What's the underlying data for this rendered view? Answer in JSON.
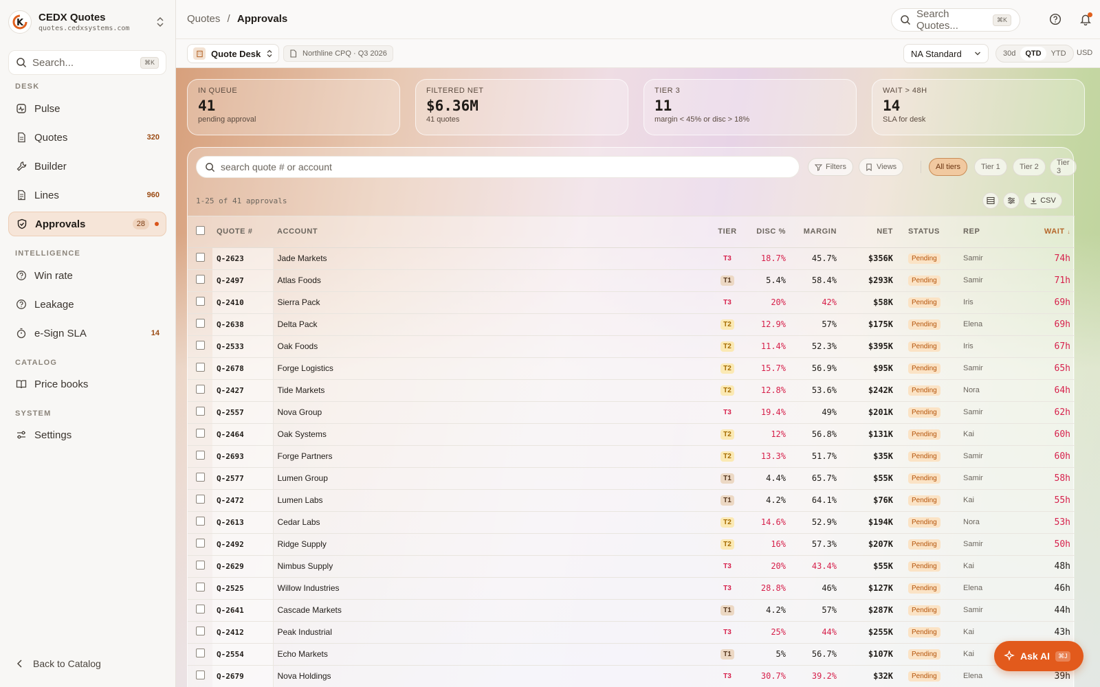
{
  "brand": {
    "name": "CEDX Quotes",
    "domain": "quotes.cedxsystems.com",
    "logo_letter": "K"
  },
  "sidebar": {
    "search_placeholder": "Search...",
    "search_shortcut": "⌘K",
    "sections": {
      "desk": "DESK",
      "intelligence": "INTELLIGENCE",
      "catalog": "CATALOG",
      "system": "SYSTEM"
    },
    "items": [
      {
        "label": "Pulse",
        "icon": "pulse-icon"
      },
      {
        "label": "Quotes",
        "count": "320",
        "icon": "document-icon"
      },
      {
        "label": "Builder",
        "icon": "wrench-icon"
      },
      {
        "label": "Lines",
        "count": "960",
        "icon": "list-icon"
      },
      {
        "label": "Approvals",
        "count": "28",
        "icon": "shield-check-icon",
        "active": true
      },
      {
        "label": "Win rate",
        "icon": "question-icon"
      },
      {
        "label": "Leakage",
        "icon": "question-icon"
      },
      {
        "label": "e-Sign SLA",
        "count": "14",
        "icon": "stopwatch-icon"
      },
      {
        "label": "Price books",
        "icon": "book-icon"
      },
      {
        "label": "Settings",
        "icon": "sliders-icon"
      }
    ],
    "back_label": "Back to Catalog"
  },
  "header": {
    "breadcrumb_parent": "Quotes",
    "breadcrumb_sep": "/",
    "breadcrumb_current": "Approvals",
    "search_placeholder": "Search Quotes...",
    "search_shortcut": "⌘K"
  },
  "toolbar": {
    "desk_label": "Quote Desk",
    "project_label": "Northline CPQ · Q3 2026",
    "region": "NA Standard",
    "ranges": [
      "30d",
      "QTD",
      "YTD"
    ],
    "active_range": "QTD",
    "currency": "USD"
  },
  "kpis": [
    {
      "label": "IN QUEUE",
      "value": "41",
      "sub": "pending approval"
    },
    {
      "label": "FILTERED NET",
      "value": "$6.36M",
      "sub": "41 quotes"
    },
    {
      "label": "TIER 3",
      "value": "11",
      "sub": "margin < 45% or disc > 18%"
    },
    {
      "label": "WAIT > 48H",
      "value": "14",
      "sub": "SLA for desk"
    }
  ],
  "filters": {
    "search_placeholder": "search quote # or account",
    "filters_label": "Filters",
    "views_label": "Views",
    "tiers": [
      "All tiers",
      "Tier 1",
      "Tier 2",
      "Tier 3"
    ],
    "active_tier": "All tiers",
    "result_count": "1-25 of 41 approvals",
    "csv_label": "CSV"
  },
  "table": {
    "columns": {
      "quote": "QUOTE #",
      "account": "ACCOUNT",
      "tier": "TIER",
      "disc": "DISC %",
      "margin": "MARGIN",
      "net": "NET",
      "status": "STATUS",
      "rep": "REP",
      "wait": "WAIT"
    },
    "rows": [
      {
        "quote": "Q-2623",
        "account": "Jade Markets",
        "tier": "T3",
        "disc": "18.7%",
        "disc_red": true,
        "margin": "45.7%",
        "margin_red": false,
        "net": "$356K",
        "status": "Pending",
        "rep": "Samir",
        "wait": "74h",
        "wait_red": true
      },
      {
        "quote": "Q-2497",
        "account": "Atlas Foods",
        "tier": "T1",
        "disc": "5.4%",
        "disc_red": false,
        "margin": "58.4%",
        "margin_red": false,
        "net": "$293K",
        "status": "Pending",
        "rep": "Samir",
        "wait": "71h",
        "wait_red": true
      },
      {
        "quote": "Q-2410",
        "account": "Sierra Pack",
        "tier": "T3",
        "disc": "20%",
        "disc_red": true,
        "margin": "42%",
        "margin_red": true,
        "net": "$58K",
        "status": "Pending",
        "rep": "Iris",
        "wait": "69h",
        "wait_red": true
      },
      {
        "quote": "Q-2638",
        "account": "Delta Pack",
        "tier": "T2",
        "disc": "12.9%",
        "disc_red": true,
        "margin": "57%",
        "margin_red": false,
        "net": "$175K",
        "status": "Pending",
        "rep": "Elena",
        "wait": "69h",
        "wait_red": true
      },
      {
        "quote": "Q-2533",
        "account": "Oak Foods",
        "tier": "T2",
        "disc": "11.4%",
        "disc_red": true,
        "margin": "52.3%",
        "margin_red": false,
        "net": "$395K",
        "status": "Pending",
        "rep": "Iris",
        "wait": "67h",
        "wait_red": true
      },
      {
        "quote": "Q-2678",
        "account": "Forge Logistics",
        "tier": "T2",
        "disc": "15.7%",
        "disc_red": true,
        "margin": "56.9%",
        "margin_red": false,
        "net": "$95K",
        "status": "Pending",
        "rep": "Samir",
        "wait": "65h",
        "wait_red": true
      },
      {
        "quote": "Q-2427",
        "account": "Tide Markets",
        "tier": "T2",
        "disc": "12.8%",
        "disc_red": true,
        "margin": "53.6%",
        "margin_red": false,
        "net": "$242K",
        "status": "Pending",
        "rep": "Nora",
        "wait": "64h",
        "wait_red": true
      },
      {
        "quote": "Q-2557",
        "account": "Nova Group",
        "tier": "T3",
        "disc": "19.4%",
        "disc_red": true,
        "margin": "49%",
        "margin_red": false,
        "net": "$201K",
        "status": "Pending",
        "rep": "Samir",
        "wait": "62h",
        "wait_red": true
      },
      {
        "quote": "Q-2464",
        "account": "Oak Systems",
        "tier": "T2",
        "disc": "12%",
        "disc_red": true,
        "margin": "56.8%",
        "margin_red": false,
        "net": "$131K",
        "status": "Pending",
        "rep": "Kai",
        "wait": "60h",
        "wait_red": true
      },
      {
        "quote": "Q-2693",
        "account": "Forge Partners",
        "tier": "T2",
        "disc": "13.3%",
        "disc_red": true,
        "margin": "51.7%",
        "margin_red": false,
        "net": "$35K",
        "status": "Pending",
        "rep": "Samir",
        "wait": "60h",
        "wait_red": true
      },
      {
        "quote": "Q-2577",
        "account": "Lumen Group",
        "tier": "T1",
        "disc": "4.4%",
        "disc_red": false,
        "margin": "65.7%",
        "margin_red": false,
        "net": "$55K",
        "status": "Pending",
        "rep": "Samir",
        "wait": "58h",
        "wait_red": true
      },
      {
        "quote": "Q-2472",
        "account": "Lumen Labs",
        "tier": "T1",
        "disc": "4.2%",
        "disc_red": false,
        "margin": "64.1%",
        "margin_red": false,
        "net": "$76K",
        "status": "Pending",
        "rep": "Kai",
        "wait": "55h",
        "wait_red": true
      },
      {
        "quote": "Q-2613",
        "account": "Cedar Labs",
        "tier": "T2",
        "disc": "14.6%",
        "disc_red": true,
        "margin": "52.9%",
        "margin_red": false,
        "net": "$194K",
        "status": "Pending",
        "rep": "Nora",
        "wait": "53h",
        "wait_red": true
      },
      {
        "quote": "Q-2492",
        "account": "Ridge Supply",
        "tier": "T2",
        "disc": "16%",
        "disc_red": true,
        "margin": "57.3%",
        "margin_red": false,
        "net": "$207K",
        "status": "Pending",
        "rep": "Samir",
        "wait": "50h",
        "wait_red": true
      },
      {
        "quote": "Q-2629",
        "account": "Nimbus Supply",
        "tier": "T3",
        "disc": "20%",
        "disc_red": true,
        "margin": "43.4%",
        "margin_red": true,
        "net": "$55K",
        "status": "Pending",
        "rep": "Kai",
        "wait": "48h",
        "wait_red": false
      },
      {
        "quote": "Q-2525",
        "account": "Willow Industries",
        "tier": "T3",
        "disc": "28.8%",
        "disc_red": true,
        "margin": "46%",
        "margin_red": false,
        "net": "$127K",
        "status": "Pending",
        "rep": "Elena",
        "wait": "46h",
        "wait_red": false
      },
      {
        "quote": "Q-2641",
        "account": "Cascade Markets",
        "tier": "T1",
        "disc": "4.2%",
        "disc_red": false,
        "margin": "57%",
        "margin_red": false,
        "net": "$287K",
        "status": "Pending",
        "rep": "Samir",
        "wait": "44h",
        "wait_red": false
      },
      {
        "quote": "Q-2412",
        "account": "Peak Industrial",
        "tier": "T3",
        "disc": "25%",
        "disc_red": true,
        "margin": "44%",
        "margin_red": true,
        "net": "$255K",
        "status": "Pending",
        "rep": "Kai",
        "wait": "43h",
        "wait_red": false
      },
      {
        "quote": "Q-2554",
        "account": "Echo Markets",
        "tier": "T1",
        "disc": "5%",
        "disc_red": false,
        "margin": "56.7%",
        "margin_red": false,
        "net": "$107K",
        "status": "Pending",
        "rep": "Kai",
        "wait": "41h",
        "wait_red": false
      },
      {
        "quote": "Q-2679",
        "account": "Nova Holdings",
        "tier": "T3",
        "disc": "30.7%",
        "disc_red": true,
        "margin": "39.2%",
        "margin_red": true,
        "net": "$32K",
        "status": "Pending",
        "rep": "Elena",
        "wait": "39h",
        "wait_red": false
      }
    ]
  },
  "assistant": {
    "label": "Ask AI",
    "shortcut": "⌘J"
  },
  "colors": {
    "accent": "#e25a1c",
    "red": "#d61f4a",
    "tier1_bg": "#ecd8c4",
    "tier2_bg": "#fbe9b4",
    "status_bg": "#fbe3c5"
  }
}
